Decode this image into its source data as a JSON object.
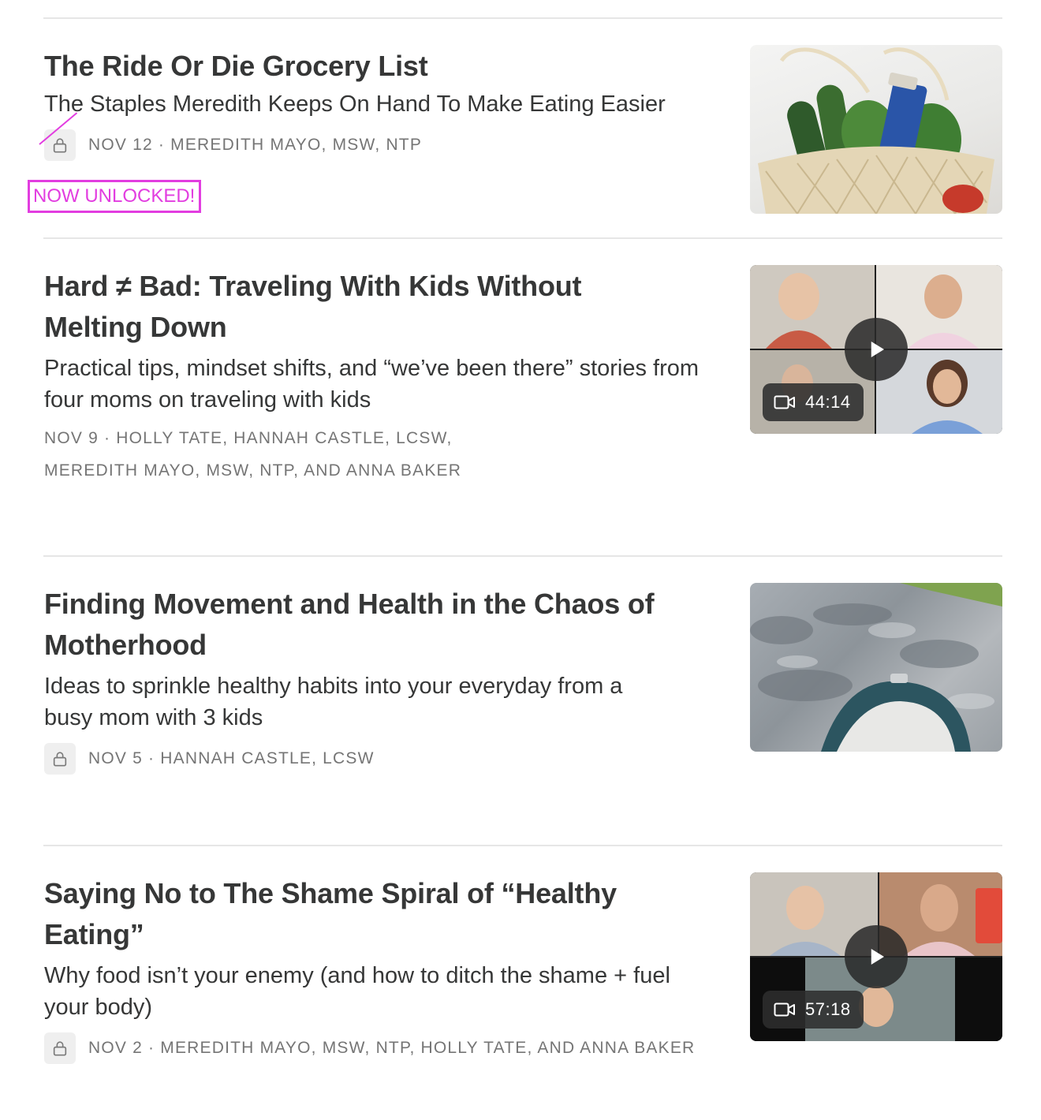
{
  "posts": [
    {
      "title": "The Ride Or Die Grocery List",
      "subtitle": "The Staples Meredith Keeps On Hand To Make Eating Easier",
      "meta": "NOV 12 · MEREDITH MAYO, MSW, NTP",
      "locked": true,
      "badge": "NOW UNLOCKED!",
      "thumbnail_icon": "grocery-bag-image"
    },
    {
      "title": "Hard ≠ Bad: Traveling With Kids Without Melting Down",
      "subtitle": "Practical tips, mindset shifts, and “we’ve been there” stories from four moms on traveling with kids",
      "meta_line1": "NOV 9 · HOLLY TATE, HANNAH CASTLE, LCSW,",
      "meta_line2": "MEREDITH MAYO, MSW, NTP, AND ANNA BAKER",
      "duration": "44:14",
      "thumbnail_icon": "video-call-image"
    },
    {
      "title": "Finding Movement and Health in the Chaos of Motherhood",
      "subtitle": "Ideas to sprinkle healthy habits into your everyday from a busy mom with 3 kids",
      "meta": "NOV 5 · HANNAH CASTLE, LCSW",
      "locked": true,
      "thumbnail_icon": "stroller-walk-image"
    },
    {
      "title": "Saying No to The Shame Spiral of “Healthy Eating”",
      "subtitle": "Why food isn’t your enemy (and how to ditch the shame + fuel your body)",
      "meta": "NOV 2 · MEREDITH MAYO, MSW, NTP, HOLLY TATE, AND ANNA BAKER",
      "locked": true,
      "duration": "57:18",
      "thumbnail_icon": "video-call-image"
    }
  ],
  "colors": {
    "text": "#363737",
    "meta": "#757575",
    "annotation": "#e23de0",
    "divider": "#e6e6e6"
  }
}
